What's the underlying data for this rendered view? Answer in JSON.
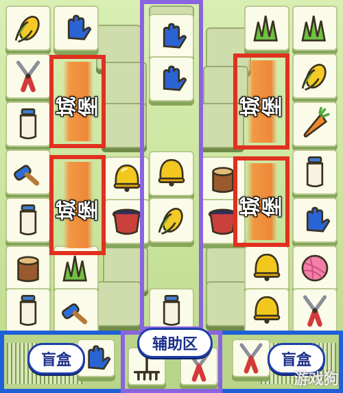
{
  "overlays": {
    "castle_label": "城堡",
    "helper_area_label": "辅助区",
    "blind_box_left": "盲盒",
    "blind_box_right": "盲盒"
  },
  "watermark": "游戏狗",
  "colors": {
    "red_frame": "#e0301f",
    "purple_frame": "#8a63e0",
    "blue_frame": "#1f5fd8",
    "castle_label_bg": "#f4923c"
  },
  "tiles": {
    "left_column_1": [
      "corn-icon",
      "pruning-shears-icon",
      "milk-bottle-icon",
      "brush-icon",
      "milk-bottle-icon",
      "tree-stump-icon",
      "milk-bottle-icon"
    ],
    "left_column_2": [
      "glove-icon",
      "",
      "",
      "bell-icon",
      "",
      "grass-icon",
      "brush-icon"
    ],
    "center_column": [
      "glove-icon",
      "glove-icon",
      "glove-icon",
      "",
      "bell-icon",
      "corn-icon",
      "",
      "",
      "milk-bottle-icon"
    ],
    "right_column_1": [
      "grass-icon",
      "",
      "",
      "",
      "",
      "bell-icon",
      "bell-icon"
    ],
    "right_column_2": [
      "grass-icon",
      "corn-icon",
      "carrot-icon",
      "milk-bottle-icon",
      "glove-icon",
      "yarn-ball-icon",
      "pruning-shears-icon"
    ]
  }
}
